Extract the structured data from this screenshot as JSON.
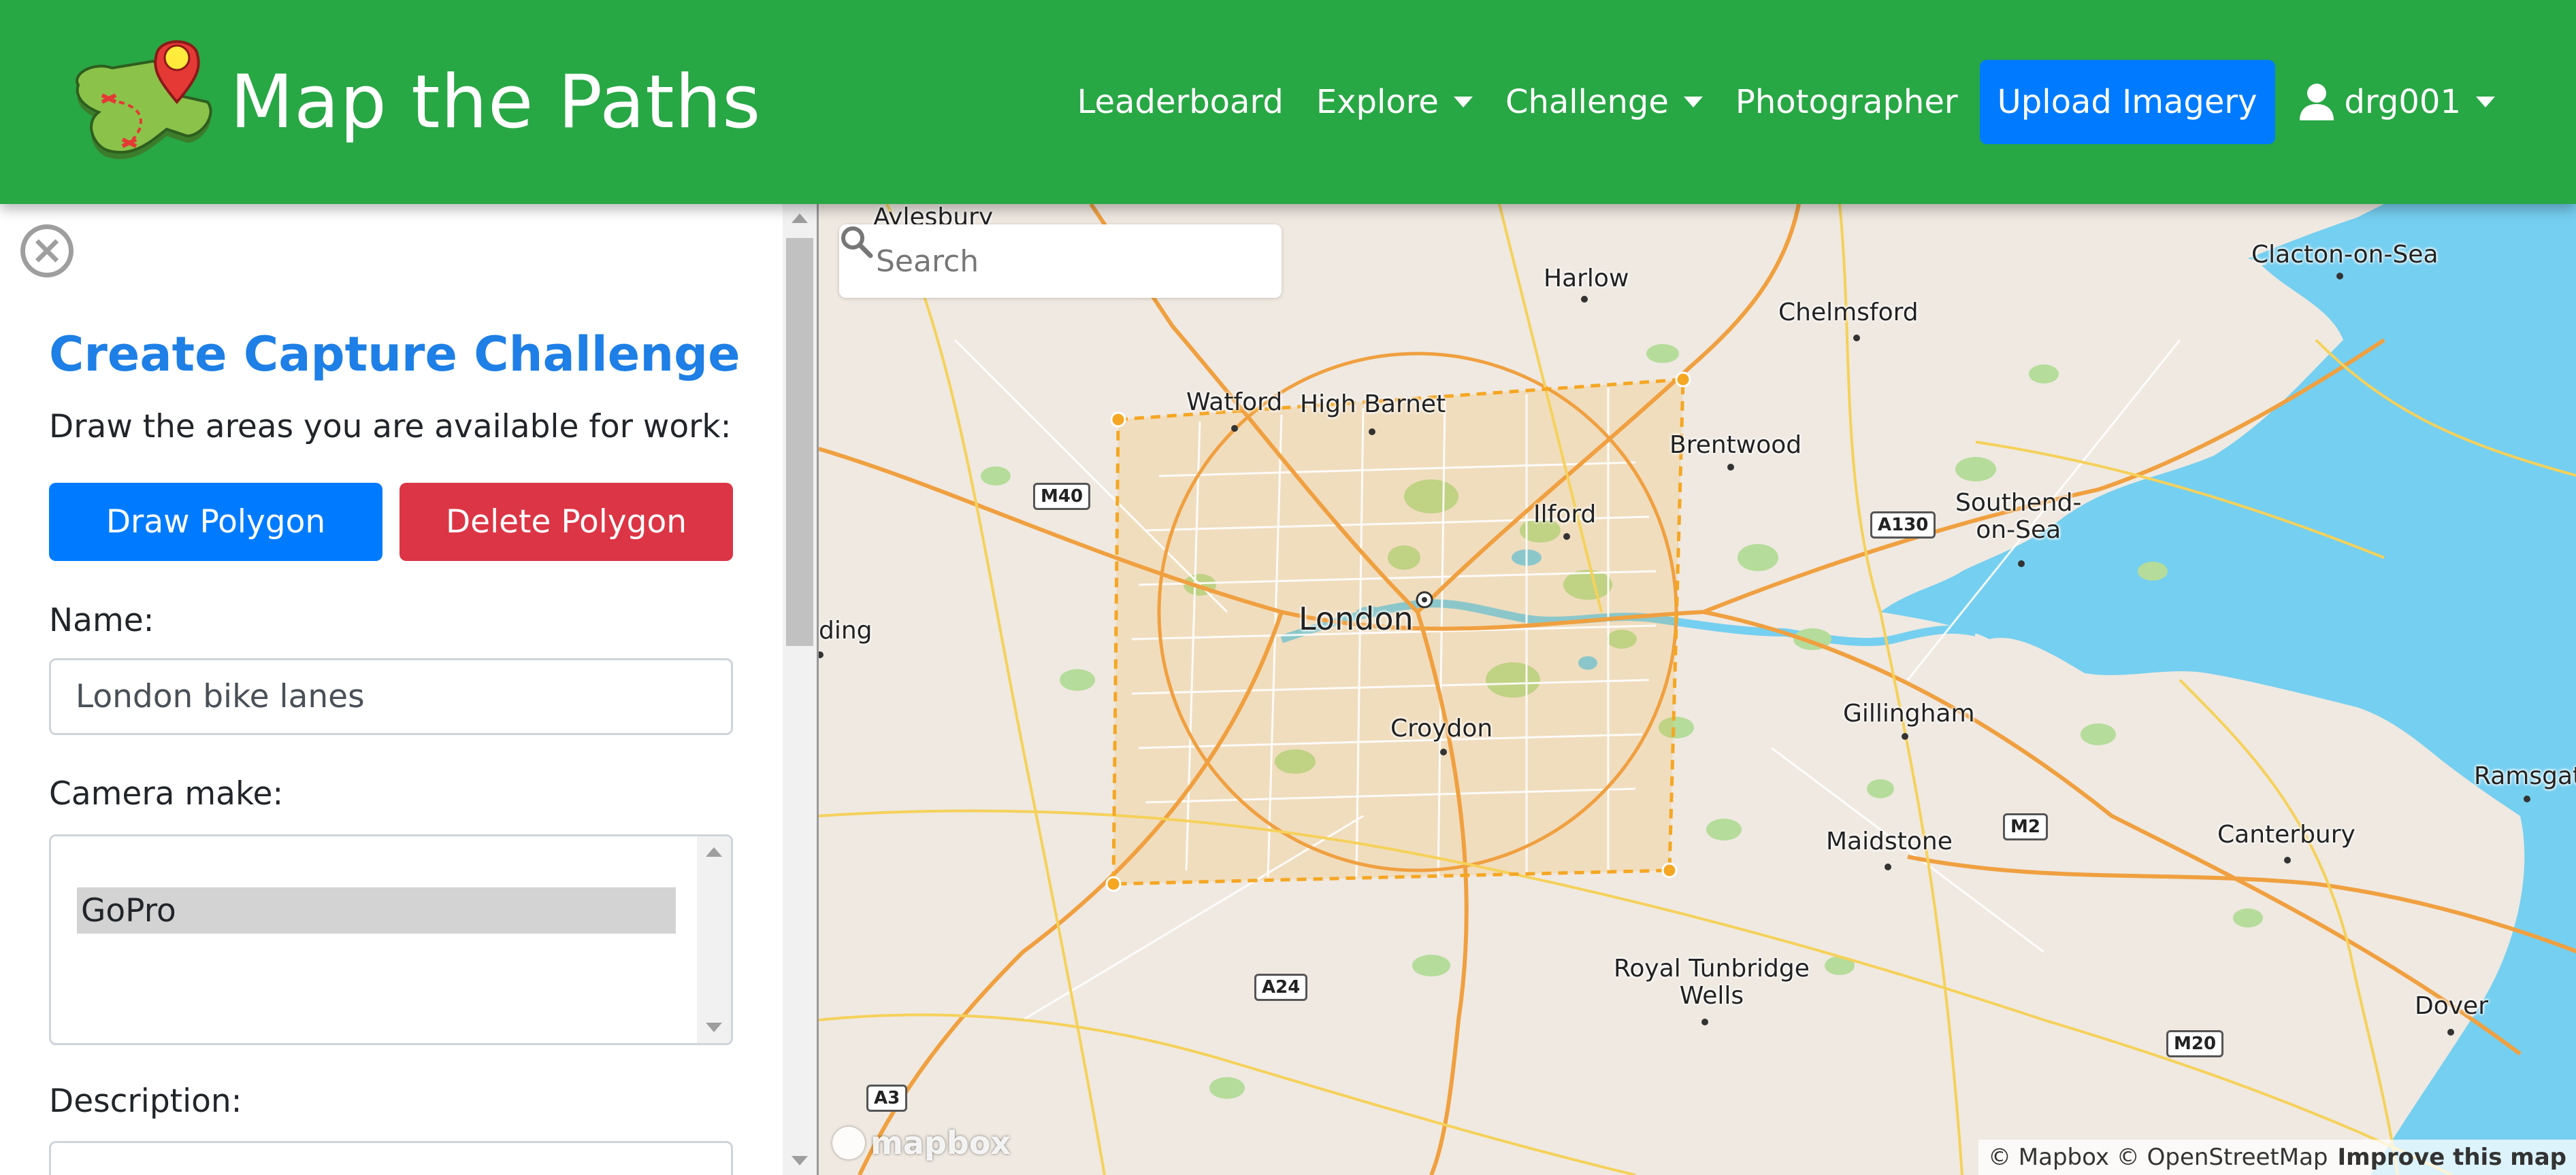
{
  "brand": {
    "title": "Map the Paths"
  },
  "nav": {
    "leaderboard": "Leaderboard",
    "explore": "Explore",
    "challenge": "Challenge",
    "photographer": "Photographer",
    "upload": "Upload Imagery",
    "user": "drg001"
  },
  "panel": {
    "close_symbol": "×",
    "title": "Create Capture Challenge",
    "subtitle": "Draw the areas you are available for work:",
    "draw_button": "Draw Polygon",
    "delete_button": "Delete Polygon",
    "name_label": "Name:",
    "name_value": "London bike lanes",
    "camera_make_label": "Camera make:",
    "camera_make_option": "GoPro",
    "description_label": "Description:"
  },
  "map": {
    "search_placeholder": "Search",
    "logo_text": "mapbox",
    "attribution": "© Mapbox © OpenStreetMap",
    "improve": "Improve this map",
    "places": {
      "aylesbury": "Aylesbury",
      "harlow": "Harlow",
      "clacton": "Clacton-on-Sea",
      "chelmsford": "Chelmsford",
      "watford": "Watford",
      "high_barnet": "High Barnet",
      "brentwood": "Brentwood",
      "southend": "Southend-\non-Sea",
      "ilford": "Ilford",
      "reading": "ding",
      "london": "London",
      "gillingham": "Gillingham",
      "croydon": "Croydon",
      "ramsgate": "Ramsgat",
      "maidstone": "Maidstone",
      "canterbury": "Canterbury",
      "tunbridge": "Royal Tunbridge\nWells",
      "dover": "Dover"
    },
    "roads": {
      "m40": "M40",
      "a130": "A130",
      "m2": "M2",
      "a24": "A24",
      "m20": "M20",
      "a3": "A3"
    },
    "colors": {
      "land": "#efe9e1",
      "water": "#75cff0",
      "park": "#b5dc9a",
      "polygon": "#f5a623"
    }
  }
}
